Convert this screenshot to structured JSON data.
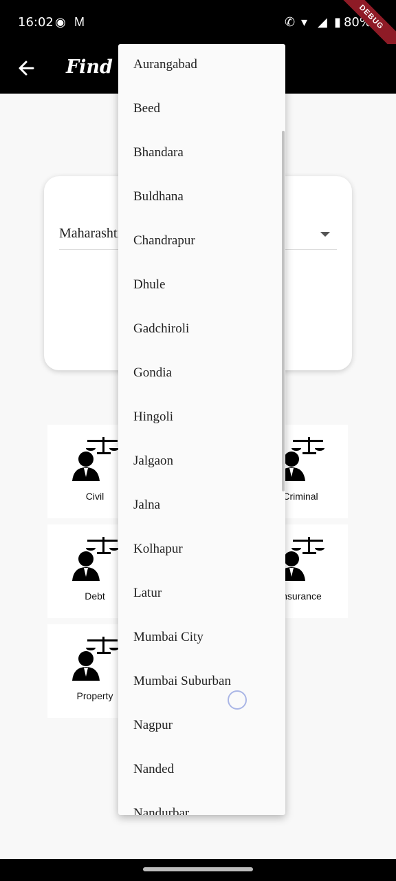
{
  "status_bar": {
    "time": "16:02",
    "battery": "80%",
    "debug_label": "DEBUG"
  },
  "app_bar": {
    "title": "Find Lawyer"
  },
  "state_field": {
    "value": "Maharashtra"
  },
  "categories": [
    {
      "label": "Civil"
    },
    {
      "label": "Criminal"
    },
    {
      "label": "Debt"
    },
    {
      "label": "Insurance"
    },
    {
      "label": "Property"
    }
  ],
  "district_dropdown": {
    "items": [
      "Aurangabad",
      "Beed",
      "Bhandara",
      "Buldhana",
      "Chandrapur",
      "Dhule",
      "Gadchiroli",
      "Gondia",
      "Hingoli",
      "Jalgaon",
      "Jalna",
      "Kolhapur",
      "Latur",
      "Mumbai City",
      "Mumbai Suburban",
      "Nagpur",
      "Nanded",
      "Nandurbar"
    ]
  },
  "colors": {
    "app_bar": "#000000",
    "background": "#f8f8f8",
    "debug_ribbon": "#8e1b26",
    "spinner": "#aab6e6"
  }
}
